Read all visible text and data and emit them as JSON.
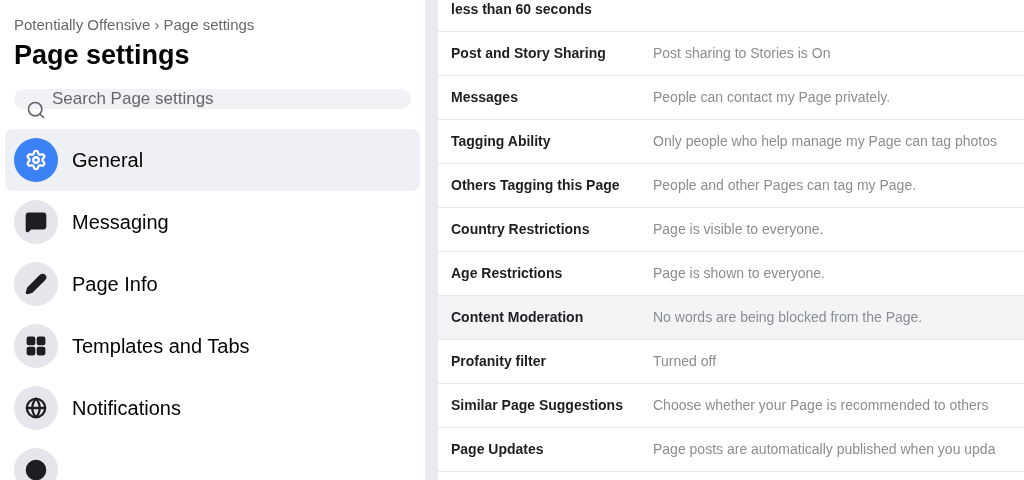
{
  "breadcrumb": {
    "parent": "Potentially Offensive",
    "separator": "›",
    "current": "Page settings"
  },
  "title": "Page settings",
  "search": {
    "placeholder": "Search Page settings"
  },
  "sidebar": {
    "items": [
      {
        "label": "General",
        "selected": true
      },
      {
        "label": "Messaging",
        "selected": false
      },
      {
        "label": "Page Info",
        "selected": false
      },
      {
        "label": "Templates and Tabs",
        "selected": false
      },
      {
        "label": "Notifications",
        "selected": false
      },
      {
        "selected": false
      }
    ]
  },
  "settings": {
    "rows": [
      {
        "label": "less than 60 seconds",
        "selected": false
      },
      {
        "label": "Post and Story Sharing",
        "value": "Post sharing to Stories is On",
        "selected": false
      },
      {
        "label": "Messages",
        "value": "People can contact my Page privately.",
        "selected": false
      },
      {
        "label": "Tagging Ability",
        "value": "Only people who help manage my Page can tag photos",
        "selected": false
      },
      {
        "label": "Others Tagging this Page",
        "value": "People and other Pages can tag my Page.",
        "selected": false
      },
      {
        "label": "Country Restrictions",
        "value": "Page is visible to everyone.",
        "selected": false
      },
      {
        "label": "Age Restrictions",
        "value": "Page is shown to everyone.",
        "selected": false
      },
      {
        "label": "Content Moderation",
        "value": "No words are being blocked from the Page.",
        "selected": true
      },
      {
        "label": "Profanity filter",
        "value": "Turned off",
        "selected": false
      },
      {
        "label": "Similar Page Suggestions",
        "value": "Choose whether your Page is recommended to others",
        "selected": false
      },
      {
        "label": "Page Updates",
        "value": "Page posts are automatically published when you upda",
        "selected": false
      }
    ]
  }
}
